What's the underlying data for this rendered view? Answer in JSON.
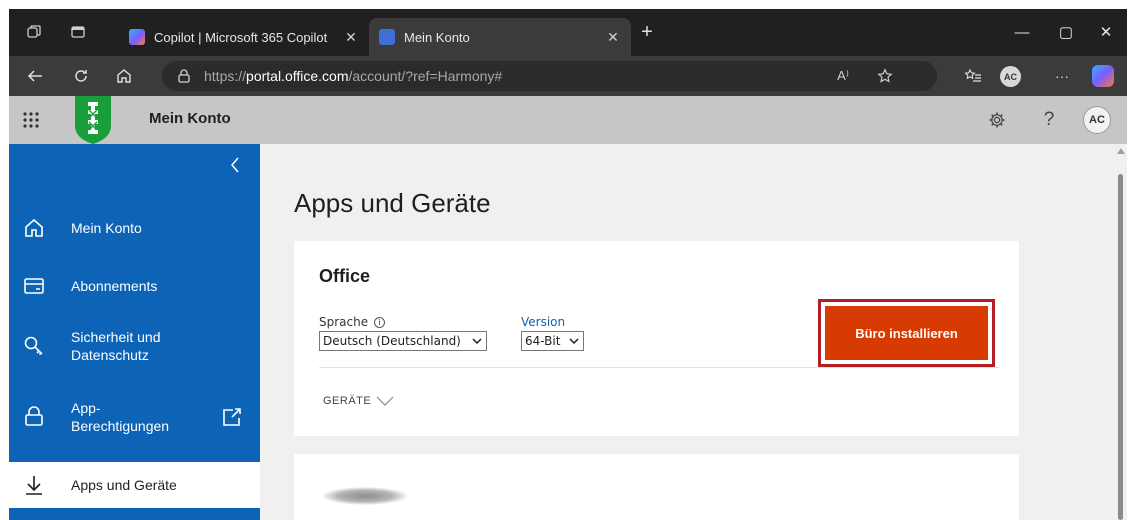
{
  "browser": {
    "tabs": [
      {
        "title": "Copilot | Microsoft 365 Copilot",
        "close": "✕"
      },
      {
        "title": "Mein Konto",
        "close": "✕"
      }
    ],
    "new_tab": "+",
    "window_controls": {
      "minimize": "—",
      "maximize": "▢",
      "close": "✕"
    },
    "address": {
      "prefix": "https://",
      "host": "portal.office.com",
      "path": "/account/?ref=Harmony#"
    },
    "profile_initials": "AC",
    "read_aloud_icon": "A⁾",
    "more_icon": "···"
  },
  "header": {
    "app_title": "Mein Konto",
    "help": "?",
    "avatar_initials": "AC"
  },
  "sidebar": {
    "items": [
      {
        "label": "Mein Konto",
        "icon": "home-icon"
      },
      {
        "label": "Abonnements",
        "icon": "card-icon"
      },
      {
        "label": "Sicherheit und Datenschutz",
        "icon": "key-icon"
      },
      {
        "label": "App-Berechtigungen",
        "icon": "lock-icon"
      },
      {
        "label": "Apps und Geräte",
        "icon": "download-icon",
        "selected": true
      }
    ]
  },
  "main": {
    "page_title": "Apps und Geräte",
    "office_card": {
      "title": "Office",
      "language_label": "Sprache",
      "info_icon": "i",
      "language_value": "Deutsch (Deutschland)",
      "version_label": "Version",
      "version_value": "64-Bit",
      "install_button": "Büro installieren",
      "devices_label": "GERÄTE"
    }
  },
  "colors": {
    "nav_blue": "#0d63b6",
    "install_orange": "#d83b01",
    "highlight_red": "#b41e24",
    "header_gray": "#c6c6c6"
  }
}
